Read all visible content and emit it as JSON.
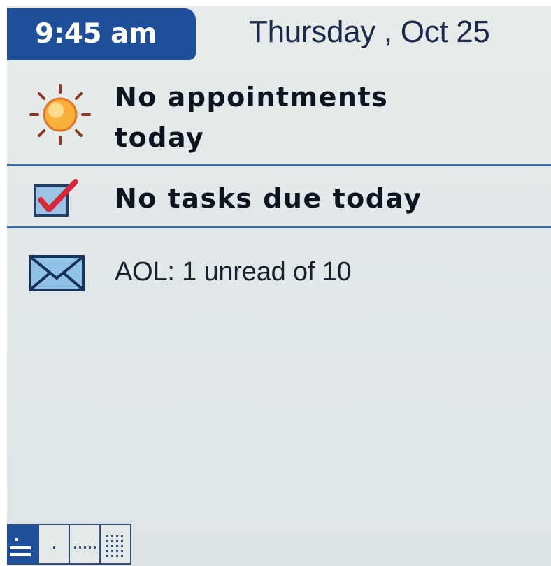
{
  "header": {
    "time": "9:45 am",
    "date": "Thursday , Oct 25"
  },
  "rows": [
    {
      "icon": "sun-icon",
      "text": "No appointments today"
    },
    {
      "icon": "checked-box-icon",
      "text": "No tasks due today"
    },
    {
      "icon": "envelope-icon",
      "text": "AOL: 1 unread of 10"
    }
  ],
  "view_bar": {
    "buttons": [
      "list-view-icon",
      "day-view-icon",
      "week-view-icon",
      "month-view-icon"
    ]
  },
  "colors": {
    "accent": "#1f4f99",
    "divider": "#3d6aa8",
    "background": "#e3e9e9",
    "sun": "#f5a326",
    "check": "#d6283a"
  }
}
